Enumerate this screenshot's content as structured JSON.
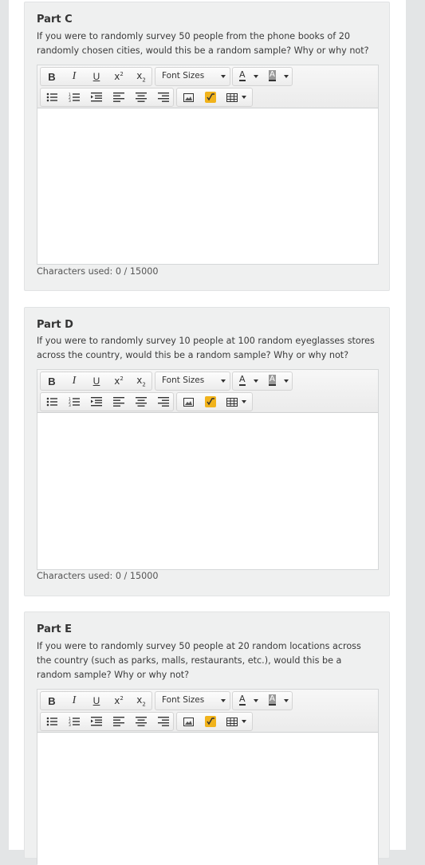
{
  "editor_toolbar": {
    "bold": "B",
    "italic": "I",
    "underline": "U",
    "superscript": "x",
    "subscript": "x",
    "font_sizes": "Font Sizes",
    "text_color": "A",
    "bg_color": "A"
  },
  "parts": [
    {
      "title": "Part C",
      "question": "If you were to randomly survey 50 people from the phone books of 20 randomly chosen cities, would this be a random sample? Why or why not?",
      "counter": "Characters used: 0 / 15000"
    },
    {
      "title": "Part D",
      "question": "If you were to randomly survey 10 people at 100 random eyeglasses stores across the country, would this be a random sample? Why or why not?",
      "counter": "Characters used: 0 / 15000"
    },
    {
      "title": "Part E",
      "question": "If you were to randomly survey 50 people at 20 random locations across the country (such as parks, malls, restaurants, etc.), would this be a random sample? Why or why not?",
      "counter": ""
    }
  ],
  "colors": {
    "page_bg": "#e3e5e6",
    "card_bg": "#eff0f0",
    "equation_icon": "#f1b31c"
  }
}
